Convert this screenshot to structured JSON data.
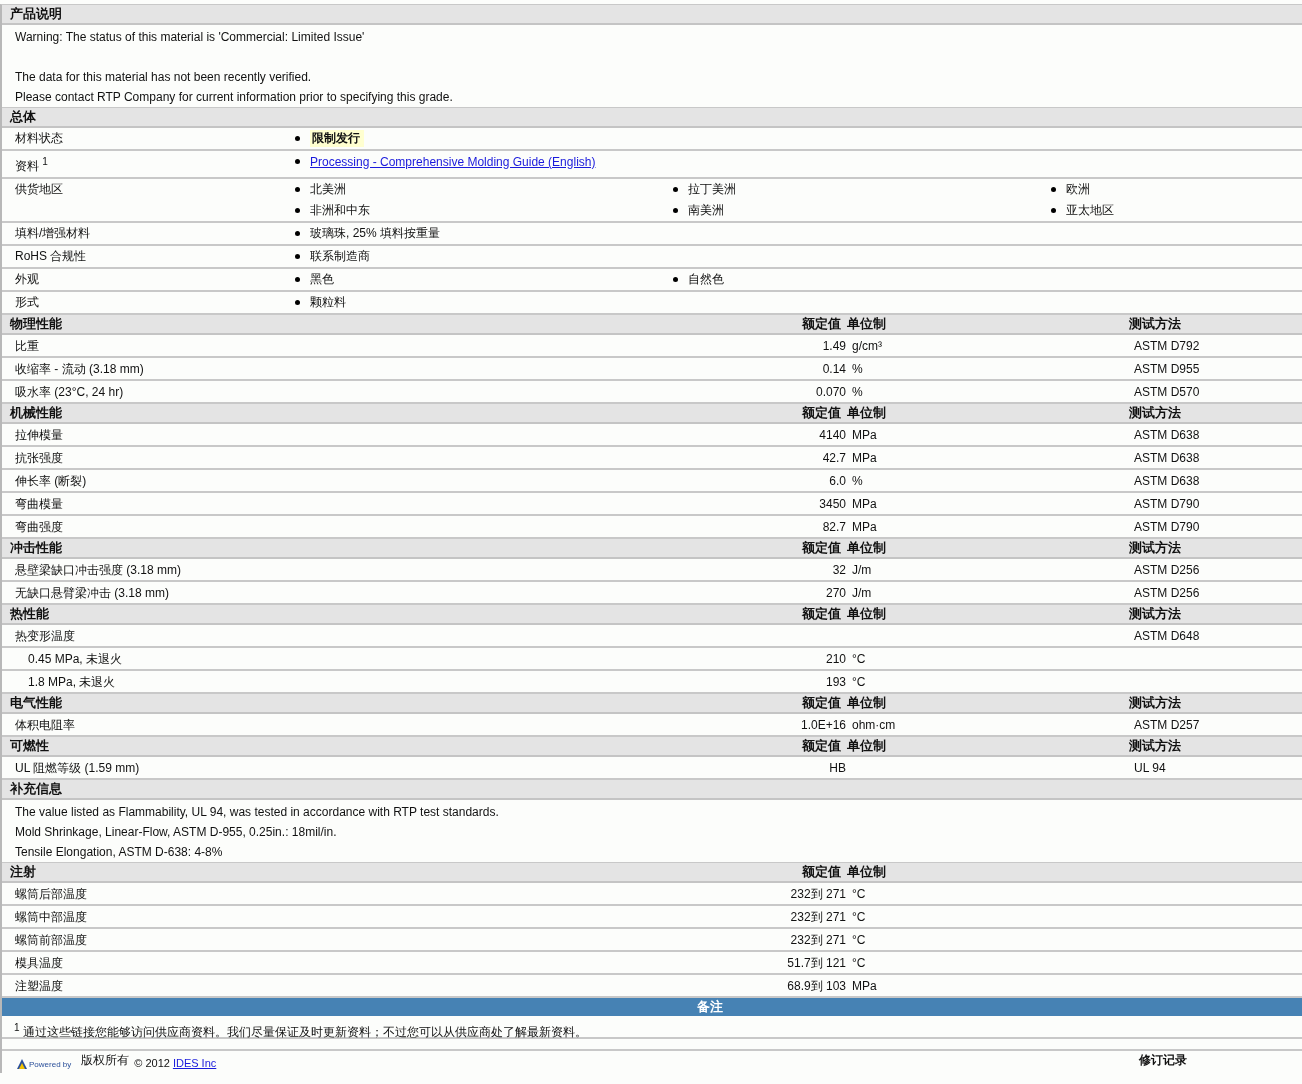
{
  "sections": [
    {
      "kind": "notes",
      "title": "产品说明",
      "paragraphs": [
        [
          "Warning: The status of this material is 'Commercial: Limited Issue'"
        ],
        [
          "The data for this material has not been recently verified.",
          "Please contact RTP Company for current information prior to specifying this grade."
        ]
      ]
    },
    {
      "kind": "general",
      "title": "总体",
      "rows": [
        {
          "label": "材料状态",
          "items": [
            {
              "kind": "status",
              "text": "限制发行"
            }
          ]
        },
        {
          "label": "资料 $^{1}$",
          "items": [
            {
              "kind": "link",
              "text": "Processing - Comprehensive Molding Guide (English)"
            }
          ]
        },
        {
          "label": "供货地区",
          "items": [
            {
              "kind": "plain",
              "text": "北美洲"
            },
            {
              "kind": "plain",
              "text": "拉丁美洲"
            },
            {
              "kind": "plain",
              "text": "欧洲"
            },
            {
              "kind": "plain",
              "text": "非洲和中东"
            },
            {
              "kind": "plain",
              "text": "南美洲"
            },
            {
              "kind": "plain",
              "text": "亚太地区"
            }
          ]
        },
        {
          "label": "填料/增强材料",
          "items": [
            {
              "kind": "plain",
              "text": "玻璃珠, 25% 填料按重量"
            }
          ]
        },
        {
          "label": "RoHS 合规性",
          "items": [
            {
              "kind": "plain",
              "text": "联系制造商"
            }
          ]
        },
        {
          "label": "外观",
          "items": [
            {
              "kind": "plain",
              "text": "黑色"
            },
            {
              "kind": "plain",
              "text": "自然色"
            }
          ]
        },
        {
          "label": "形式",
          "items": [
            {
              "kind": "plain",
              "text": "颗粒料"
            }
          ]
        }
      ]
    },
    {
      "kind": "properties",
      "title": "物理性能",
      "columns": [
        "额定值",
        "单位制",
        "测试方法"
      ],
      "rows": [
        {
          "label": "比重",
          "value": "1.49",
          "unit": "g/cm³",
          "method": "ASTM D792"
        },
        {
          "label": "收缩率 - 流动 (3.18 mm)",
          "value": "0.14",
          "unit": "%",
          "method": "ASTM D955"
        },
        {
          "label": "吸水率 (23°C, 24 hr)",
          "value": "0.070",
          "unit": "%",
          "method": "ASTM D570"
        }
      ]
    },
    {
      "kind": "properties",
      "title": "机械性能",
      "columns": [
        "额定值",
        "单位制",
        "测试方法"
      ],
      "rows": [
        {
          "label": "拉伸模量",
          "value": "4140",
          "unit": "MPa",
          "method": "ASTM D638"
        },
        {
          "label": "抗张强度",
          "value": "42.7",
          "unit": "MPa",
          "method": "ASTM D638"
        },
        {
          "label": "伸长率 (断裂)",
          "value": "6.0",
          "unit": "%",
          "method": "ASTM D638"
        },
        {
          "label": "弯曲模量",
          "value": "3450",
          "unit": "MPa",
          "method": "ASTM D790"
        },
        {
          "label": "弯曲强度",
          "value": "82.7",
          "unit": "MPa",
          "method": "ASTM D790"
        }
      ]
    },
    {
      "kind": "properties",
      "title": "冲击性能",
      "columns": [
        "额定值",
        "单位制",
        "测试方法"
      ],
      "rows": [
        {
          "label": "悬壁梁缺口冲击强度 (3.18 mm)",
          "value": "32",
          "unit": "J/m",
          "method": "ASTM D256"
        },
        {
          "label": "无缺口悬臂梁冲击 (3.18 mm)",
          "value": "270",
          "unit": "J/m",
          "method": "ASTM D256"
        }
      ]
    },
    {
      "kind": "properties",
      "title": "热性能",
      "columns": [
        "额定值",
        "单位制",
        "测试方法"
      ],
      "rows": [
        {
          "label": "热变形温度",
          "method": "ASTM D648",
          "children": [
            {
              "label": "0.45 MPa, 未退火",
              "value": "210",
              "unit": "°C"
            },
            {
              "label": "1.8 MPa, 未退火",
              "value": "193",
              "unit": "°C"
            }
          ]
        }
      ]
    },
    {
      "kind": "properties",
      "title": "电气性能",
      "columns": [
        "额定值",
        "单位制",
        "测试方法"
      ],
      "rows": [
        {
          "label": "体积电阻率",
          "value": "1.0E+16",
          "unit": "ohm·cm",
          "method": "ASTM D257"
        }
      ]
    },
    {
      "kind": "properties",
      "title": "可燃性",
      "columns": [
        "额定值",
        "单位制",
        "测试方法"
      ],
      "rows": [
        {
          "label": "UL 阻燃等级 (1.59 mm)",
          "value": "HB",
          "method": "UL 94"
        }
      ]
    },
    {
      "kind": "notes",
      "title": "补充信息",
      "paragraphs": [
        [
          "The value listed as Flammability, UL 94, was tested in accordance with RTP test standards.",
          "Mold Shrinkage, Linear-Flow, ASTM D-955, 0.25in.: 18mil/in.",
          "Tensile Elongation, ASTM D-638: 4-8%"
        ]
      ]
    },
    {
      "kind": "properties",
      "title": "注射",
      "columns": [
        "额定值",
        "单位制"
      ],
      "rows": [
        {
          "label": "螺筒后部温度",
          "value": "232到 271",
          "unit": "°C"
        },
        {
          "label": "螺筒中部温度",
          "value": "232到 271",
          "unit": "°C"
        },
        {
          "label": "螺筒前部温度",
          "value": "232到 271",
          "unit": "°C"
        },
        {
          "label": "模具温度",
          "value": "51.7到 121",
          "unit": "°C"
        },
        {
          "label": "注塑温度",
          "value": "68.9到 103",
          "unit": "MPa"
        }
      ]
    },
    {
      "kind": "footnotes",
      "title": "备注",
      "notes": [
        "$^{1}$ 通过这些链接您能够访问供应商资料。我们尽量保证及时更新资料；不过您可以从供应商处了解最新资料。"
      ]
    }
  ],
  "footer": {
    "powered_by": "Powered by",
    "copyright": "版权所有",
    "year": "© 2012",
    "company": "IDES Inc",
    "revisions": "修订记录"
  }
}
